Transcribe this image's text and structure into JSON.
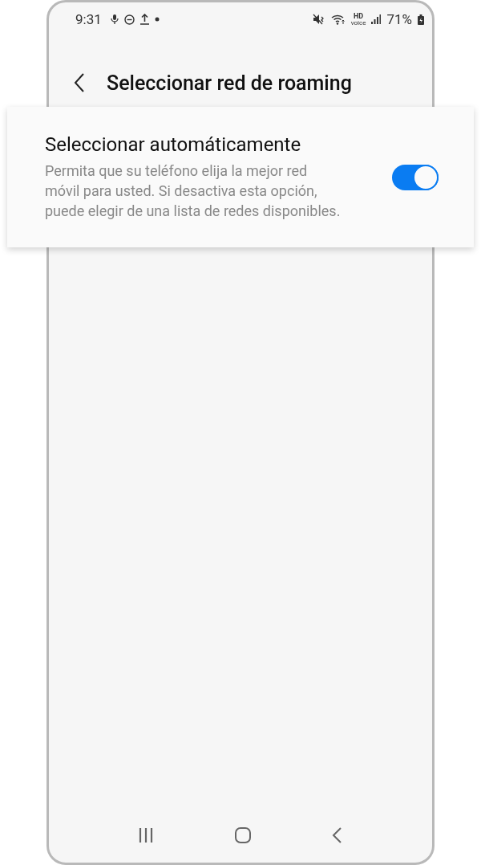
{
  "status_bar": {
    "time": "9:31",
    "hd_label": "HD",
    "voice_label": "voice",
    "battery": "71%"
  },
  "header": {
    "title": "Seleccionar red de roaming"
  },
  "setting": {
    "title": "Seleccionar automáticamente",
    "description": "Permita que su teléfono elija la mejor red móvil para usted. Si desactiva esta opción, puede elegir de una lista de redes disponibles.",
    "on": true
  }
}
